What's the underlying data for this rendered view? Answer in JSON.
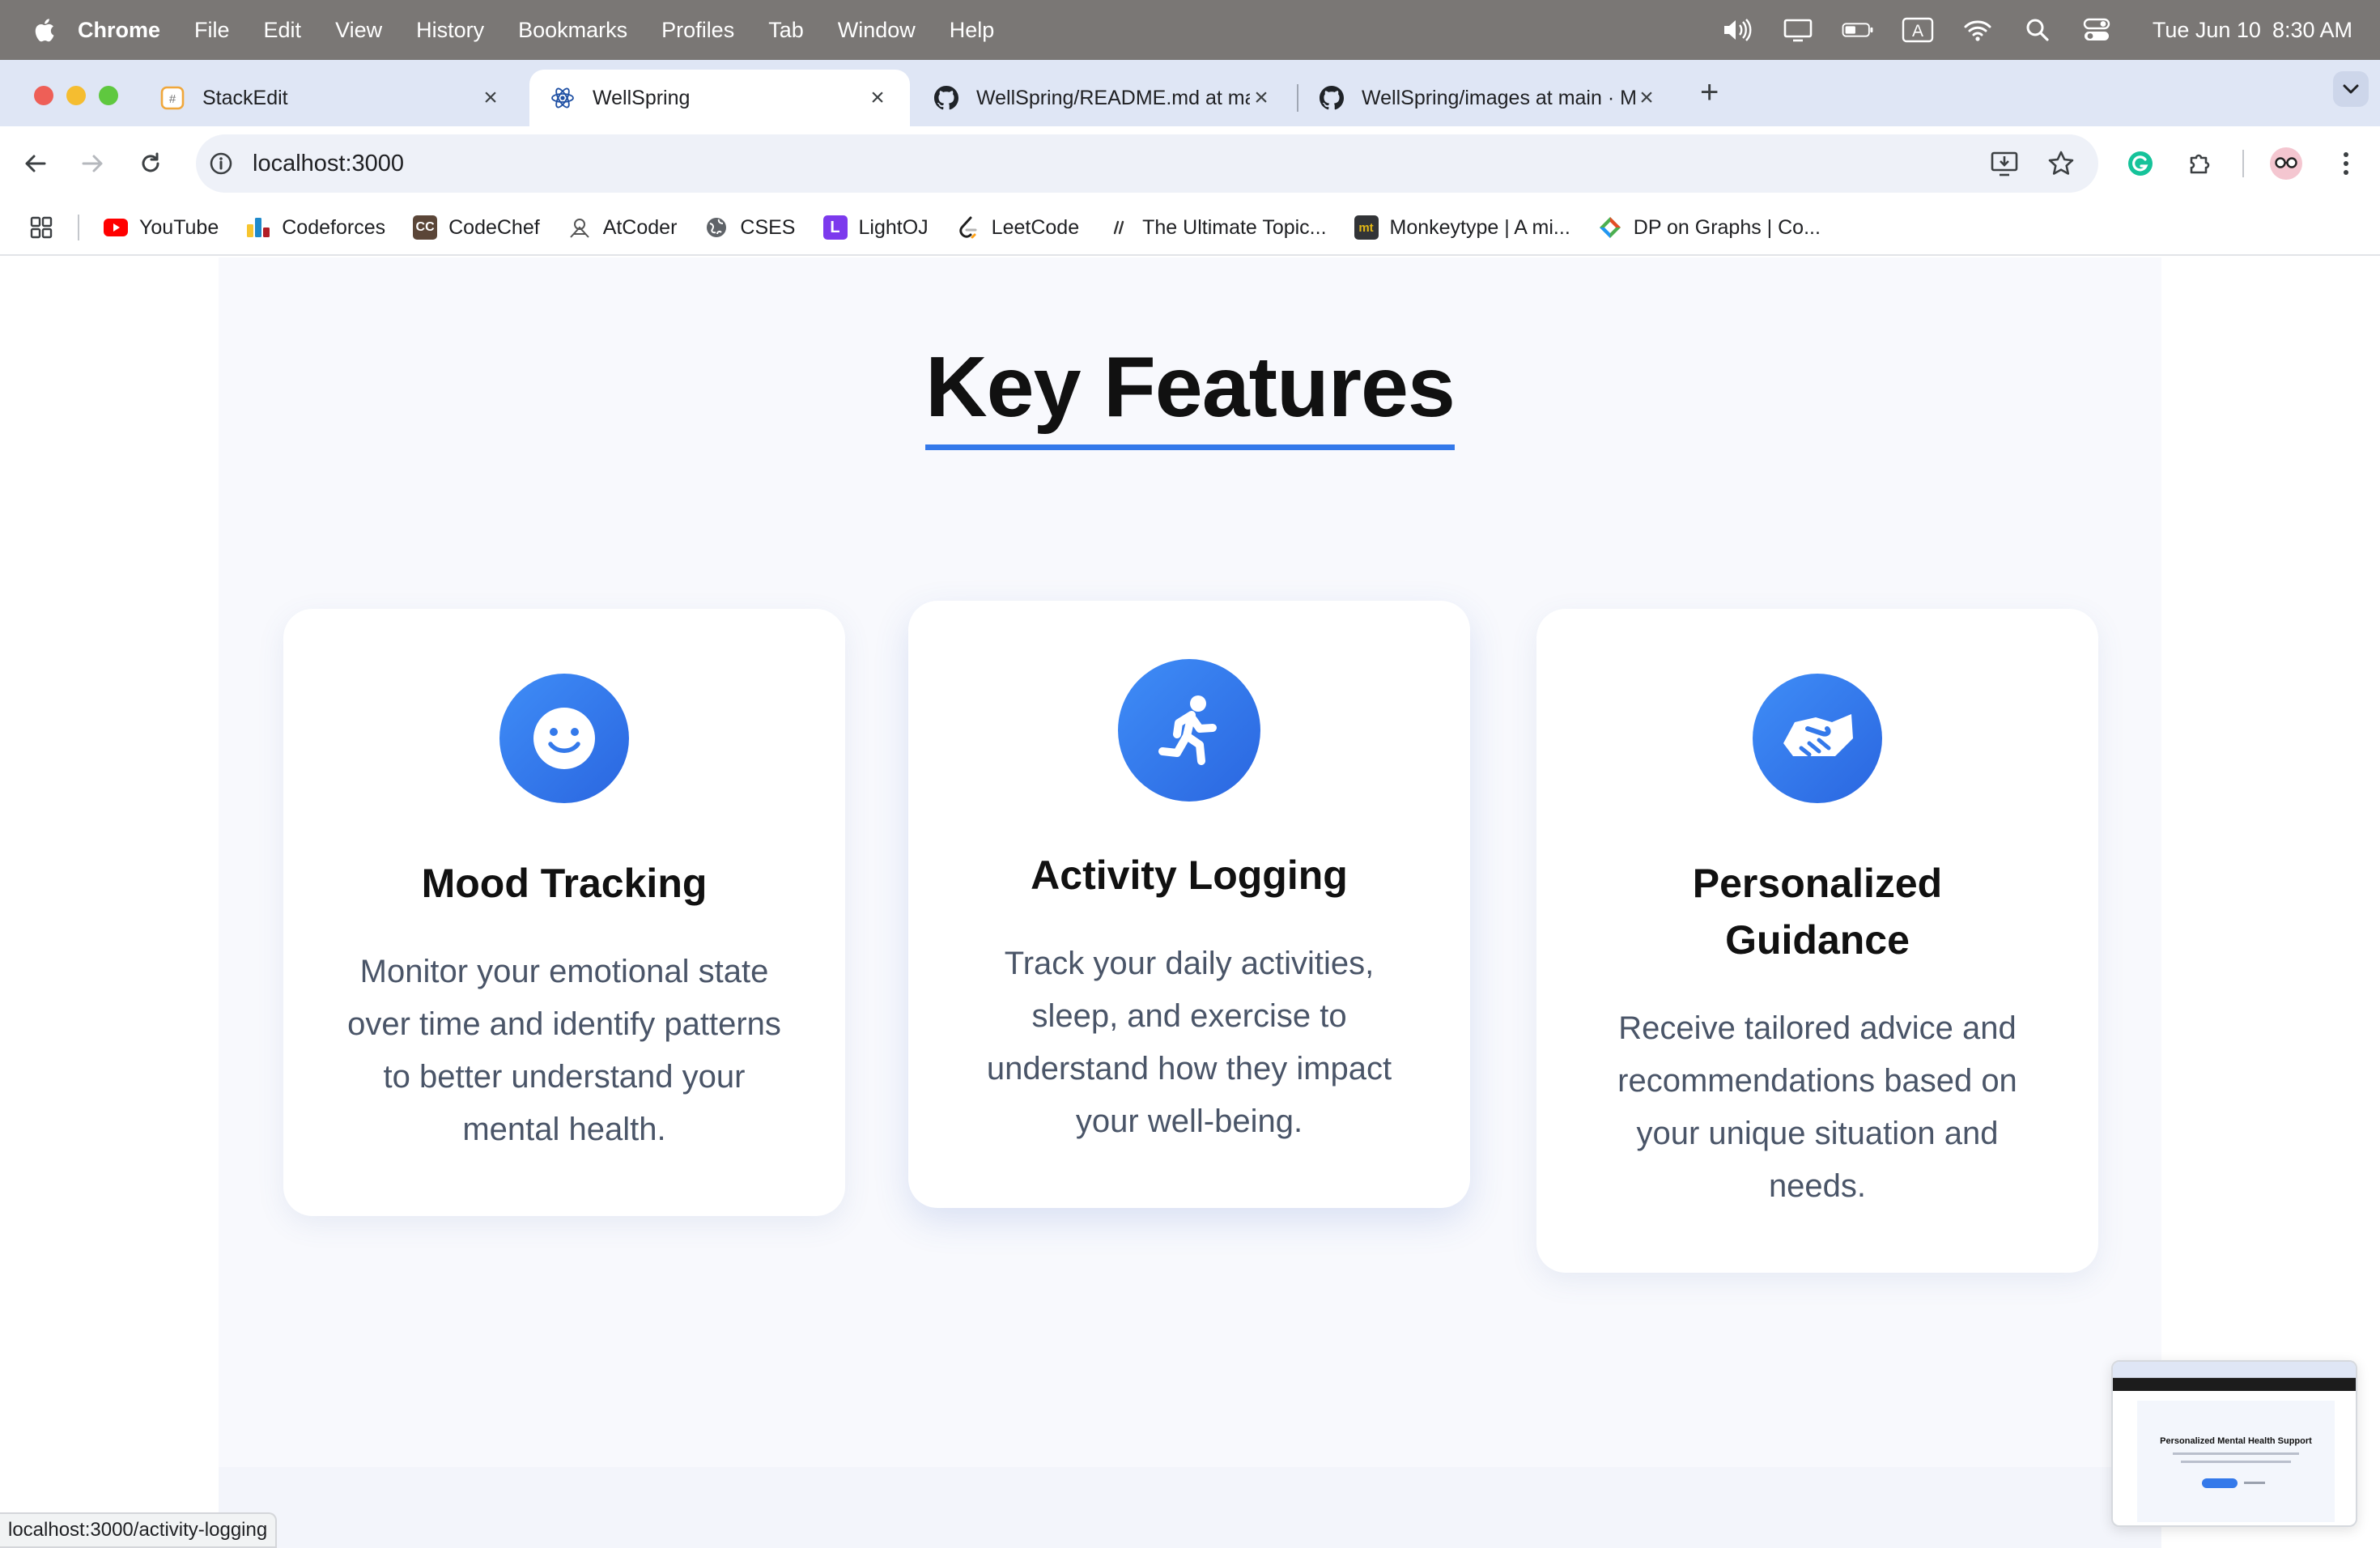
{
  "menubar": {
    "app_name": "Chrome",
    "items": [
      "File",
      "Edit",
      "View",
      "History",
      "Bookmarks",
      "Profiles",
      "Tab",
      "Window",
      "Help"
    ],
    "date": "Tue Jun 10",
    "time": "8:30 AM",
    "input_source": "A"
  },
  "tabs": [
    {
      "title": "StackEdit",
      "icon": "stackedit-icon"
    },
    {
      "title": "WellSpring",
      "icon": "react-icon",
      "active": true
    },
    {
      "title": "WellSpring/README.md at ma",
      "icon": "github-icon"
    },
    {
      "title": "WellSpring/images at main · M",
      "icon": "github-icon"
    }
  ],
  "toolbar": {
    "url": "localhost:3000"
  },
  "bookmarks": [
    {
      "label": "YouTube",
      "icon": "youtube-icon",
      "color": "#ff0000"
    },
    {
      "label": "Codeforces",
      "icon": "codeforces-icon",
      "color": "#1f8acb"
    },
    {
      "label": "CodeChef",
      "icon": "codechef-icon",
      "color": "#5b4638"
    },
    {
      "label": "AtCoder",
      "icon": "atcoder-icon",
      "color": "#555555"
    },
    {
      "label": "CSES",
      "icon": "globe-icon",
      "color": "#5f6368"
    },
    {
      "label": "LightOJ",
      "icon": "lightoj-icon",
      "color": "#7c3aed"
    },
    {
      "label": "LeetCode",
      "icon": "leetcode-icon",
      "color": "#ffa116"
    },
    {
      "label": "The Ultimate Topic...",
      "icon": "link-icon",
      "color": "#333333"
    },
    {
      "label": "Monkeytype | A mi...",
      "icon": "monkeytype-icon",
      "color": "#e2b714"
    },
    {
      "label": "DP on Graphs | Co...",
      "icon": "codeforces-diamond-icon",
      "color": "#e44d26"
    }
  ],
  "page": {
    "heading": "Key Features",
    "accent_color": "#3479ea",
    "features": [
      {
        "title": "Mood Tracking",
        "description": "Monitor your emotional state over time and identify patterns to better understand your mental health.",
        "icon": "smiley-icon"
      },
      {
        "title": "Activity Logging",
        "description": "Track your daily activities, sleep, and exercise to understand how they impact your well-being.",
        "icon": "running-person-icon",
        "hovered": true
      },
      {
        "title": "Personalized Guidance",
        "description": "Receive tailored advice and recommendations based on your unique situation and needs.",
        "icon": "handshake-icon"
      }
    ]
  },
  "status_bar": {
    "link_url": "localhost:3000/activity-logging"
  },
  "thumbnail": {
    "title": "Personalized Mental Health Support"
  }
}
